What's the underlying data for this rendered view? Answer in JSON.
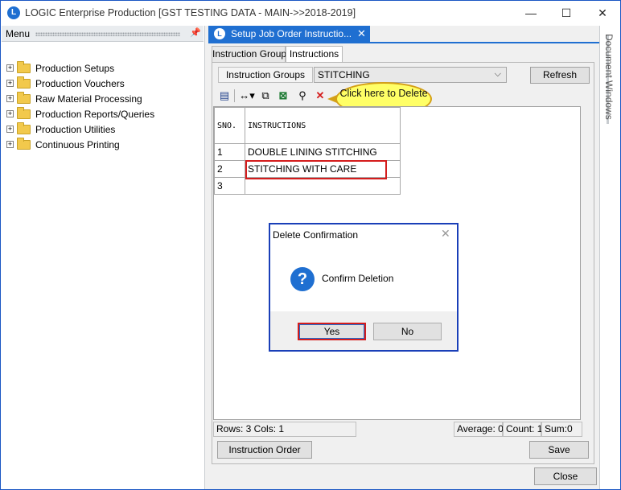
{
  "app": {
    "title": "LOGIC Enterprise Production  [GST TESTING DATA - MAIN->>2018-2019]",
    "minimize": "—",
    "maximize": "☐",
    "close": "✕"
  },
  "menu": {
    "header": "Menu",
    "items": [
      {
        "label": "Production Setups"
      },
      {
        "label": "Production Vouchers"
      },
      {
        "label": "Raw Material Processing"
      },
      {
        "label": "Production Reports/Queries"
      },
      {
        "label": "Production Utilities"
      },
      {
        "label": "Continuous Printing"
      }
    ]
  },
  "document_tab": {
    "label": "Setup Job Order Instructio...",
    "close": "✕"
  },
  "inner_tabs": [
    {
      "label": "Instruction Group",
      "active": false
    },
    {
      "label": "Instructions",
      "active": true
    }
  ],
  "groups": {
    "label": "Instruction Groups",
    "selected": "STITCHING",
    "refresh_label": "Refresh"
  },
  "toolbar": {
    "icons": [
      "new-record-icon",
      "resize-columns-icon",
      "copy-icon",
      "excel-export-icon",
      "find-icon",
      "delete-icon"
    ]
  },
  "callout": {
    "text": "Click here to Delete"
  },
  "grid": {
    "columns": [
      "SNO.",
      "INSTRUCTIONS"
    ],
    "rows": [
      {
        "sno": "1",
        "instruction": "DOUBLE LINING STITCHING"
      },
      {
        "sno": "2",
        "instruction": "STITCHING WITH CARE"
      },
      {
        "sno": "3",
        "instruction": ""
      }
    ]
  },
  "status": {
    "rows_cols": "Rows: 3  Cols: 1",
    "average": "Average: 0",
    "count": "Count: 1",
    "sum": "Sum:0"
  },
  "buttons": {
    "instruction_order": "Instruction Order",
    "save": "Save",
    "close": "Close"
  },
  "dialog": {
    "title": "Delete Confirmation",
    "message": "Confirm Deletion",
    "yes": "Yes",
    "no": "No",
    "close": "✕"
  },
  "document_windows": {
    "label": "Document Windows"
  }
}
